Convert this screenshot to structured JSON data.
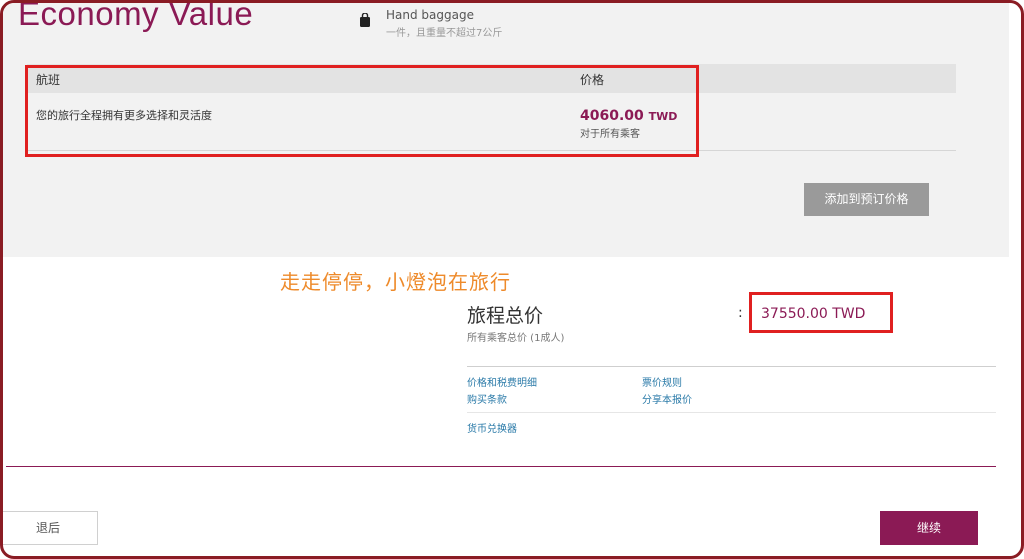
{
  "fare": {
    "title": "Economy Value",
    "baggage_title": "Hand baggage",
    "baggage_desc": "一件，且重量不超过7公斤"
  },
  "table": {
    "col_flight": "航班",
    "col_price": "价格",
    "row_desc": "您的旅行全程拥有更多选择和灵活度",
    "row_price": "4060.00",
    "row_currency": "TWD",
    "row_note": "对于所有乘客"
  },
  "add_button": "添加到预订价格",
  "watermark": "走走停停，小燈泡在旅行",
  "total": {
    "title": "旅程总价",
    "subtitle": "所有乘客总价 (1成人)",
    "colon": ":",
    "value": "37550.00 TWD"
  },
  "links": {
    "price_breakdown": "价格和税费明细",
    "purchase_terms": "购买条款",
    "fare_rules": "票价规则",
    "share_quote": "分享本报价",
    "currency_converter": "货币兑换器"
  },
  "nav": {
    "back": "退后",
    "continue": "继续"
  },
  "colors": {
    "brand": "#8b1a55",
    "annotation_red": "#e02020",
    "watermark_orange": "#ee8a2a",
    "link_blue": "#2a7aa8"
  }
}
